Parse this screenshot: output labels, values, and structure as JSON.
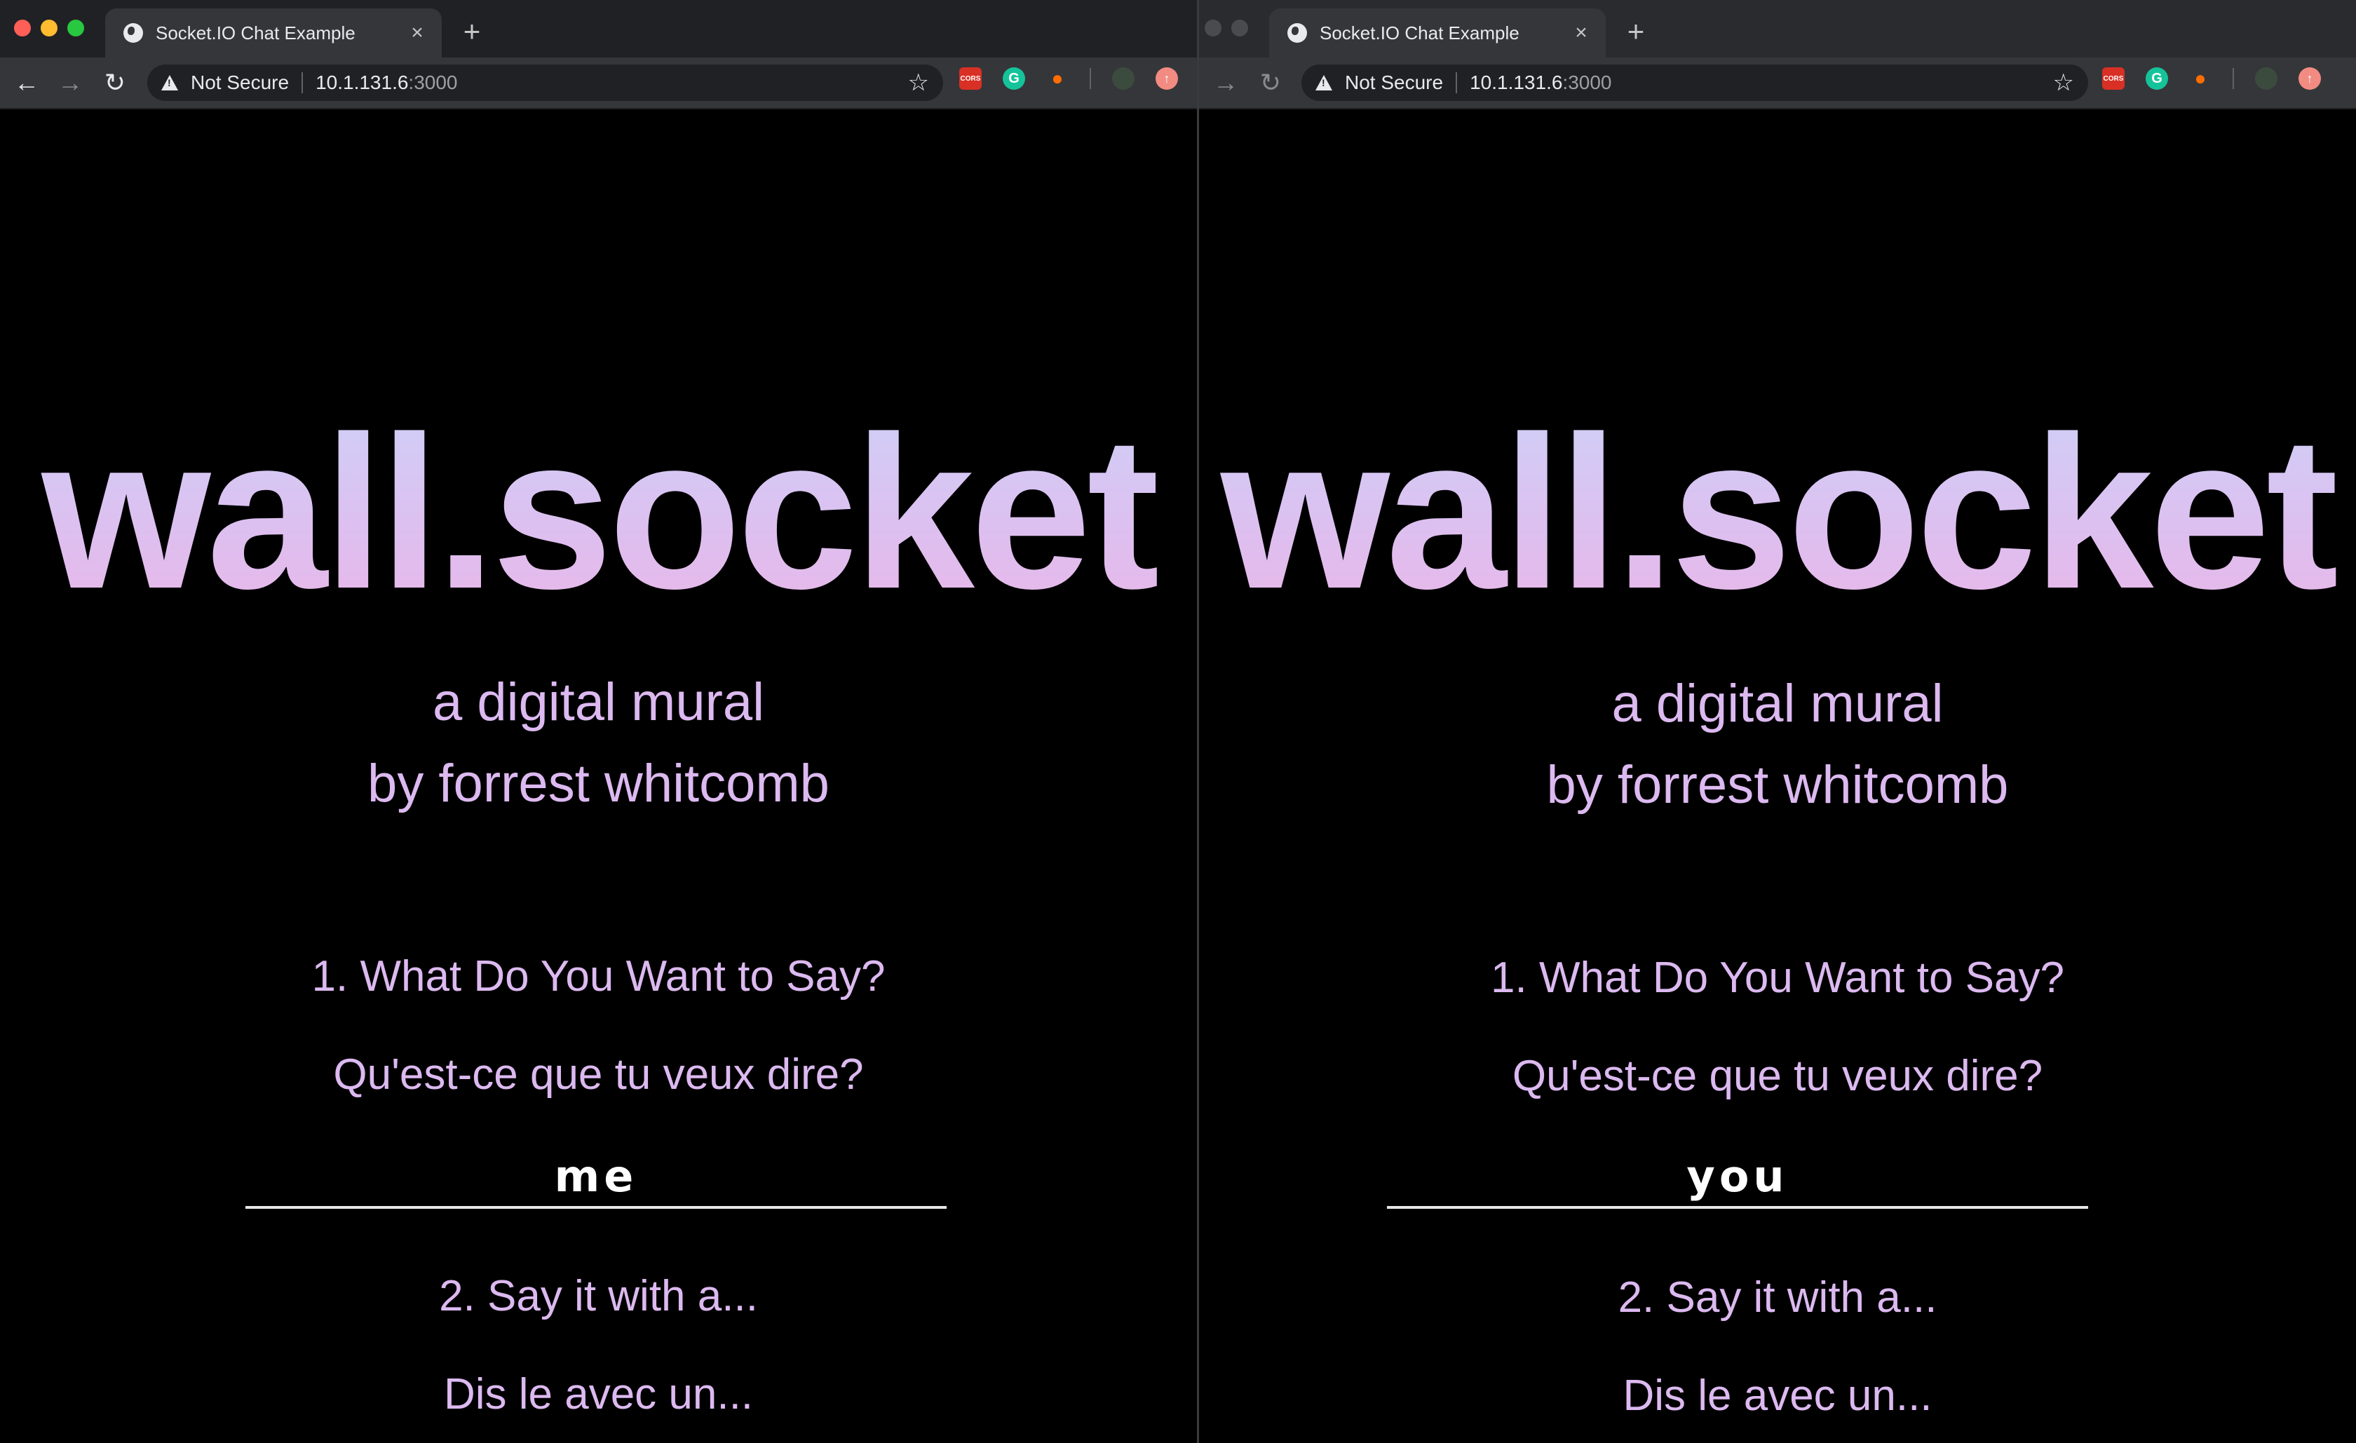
{
  "tab": {
    "title": "Socket.IO Chat Example",
    "close_glyph": "×",
    "new_tab_glyph": "+"
  },
  "address_bar": {
    "security_label": "Not Secure",
    "host": "10.1.131.6",
    "port": ":3000"
  },
  "extensions": {
    "cors_label": "CORS",
    "grammarly_label": "G"
  },
  "page": {
    "logo": "wall.socket",
    "subtitle_line1": "a digital mural",
    "subtitle_line2": "by forrest whitcomb",
    "question1_en": "1. What Do You Want to Say?",
    "question1_fr": "Qu'est-ce que tu veux dire?",
    "question2_en": "2. Say it with a...",
    "question2_fr": "Dis le avec un..."
  },
  "windows": {
    "left": {
      "message_value": "me"
    },
    "right": {
      "message_value": "you"
    }
  },
  "colors": {
    "accent_text": "#dcb9f0",
    "background": "#000000",
    "chrome_dark": "#202124",
    "chrome_toolbar": "#35363a"
  }
}
